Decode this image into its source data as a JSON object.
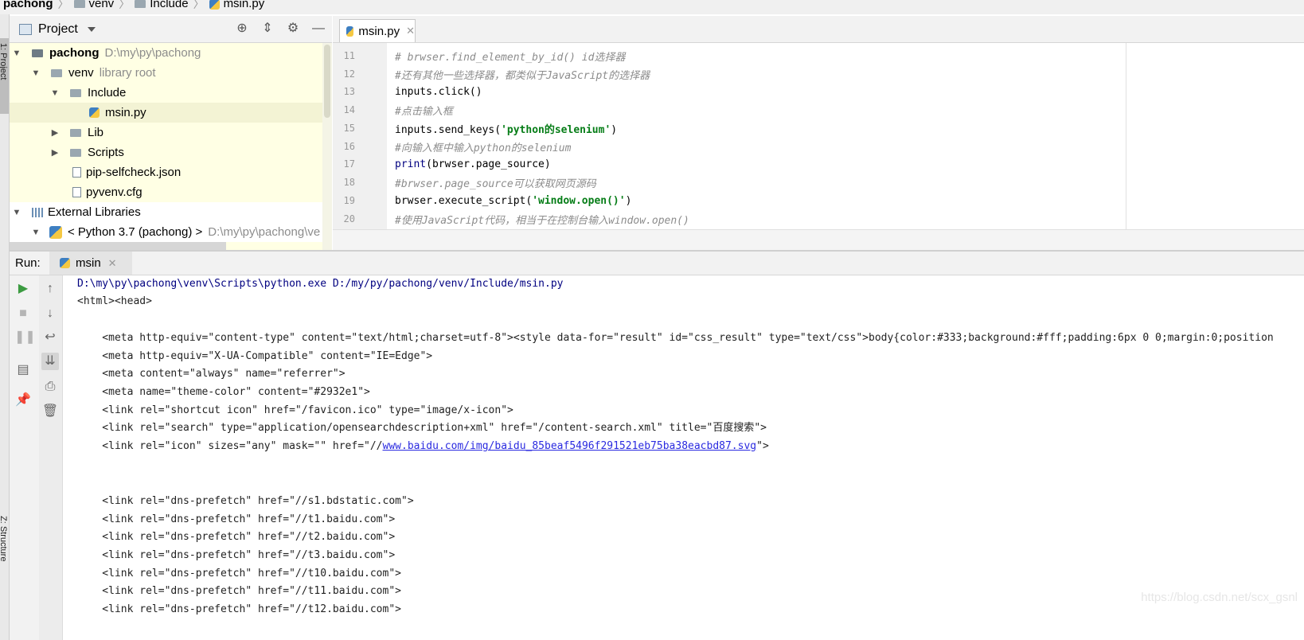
{
  "breadcrumb": [
    "pachong",
    "venv",
    "Include",
    "msin.py"
  ],
  "side_stripe": {
    "project_label": "1: Project",
    "structure_label": "Z: Structure"
  },
  "project_panel": {
    "title": "Project",
    "tree": [
      {
        "label": "pachong",
        "hint": "D:\\my\\py\\pachong",
        "icon": "folder-icon"
      },
      {
        "label": "venv",
        "hint": "library root",
        "icon": "folder-icon"
      },
      {
        "label": "Include",
        "hint": "",
        "icon": "folder-icon"
      },
      {
        "label": "msin.py",
        "hint": "",
        "icon": "python-file-icon"
      },
      {
        "label": "Lib",
        "hint": "",
        "icon": "folder-icon"
      },
      {
        "label": "Scripts",
        "hint": "",
        "icon": "folder-icon"
      },
      {
        "label": "pip-selfcheck.json",
        "hint": "",
        "icon": "json-file-icon"
      },
      {
        "label": "pyvenv.cfg",
        "hint": "",
        "icon": "config-file-icon"
      },
      {
        "label": "External Libraries",
        "hint": "",
        "icon": "library-icon"
      },
      {
        "label": "< Python 3.7 (pachong) >",
        "hint": "D:\\my\\py\\pachong\\ve",
        "icon": "python-icon"
      }
    ]
  },
  "editor": {
    "tab": "msin.py",
    "line_numbers": [
      "11",
      "12",
      "13",
      "14",
      "15",
      "16",
      "17",
      "18",
      "19",
      "20"
    ],
    "lines": [
      {
        "a": "# brwser.find_element_by_id()   id选择器",
        "b": "",
        "c": ""
      },
      {
        "a": "#还有其他一些选择器，都类似于JavaScript的选择器",
        "b": "",
        "c": ""
      },
      {
        "a": "inputs.click()",
        "b": "",
        "c": ""
      },
      {
        "a": "#点击输入框",
        "b": "",
        "c": ""
      },
      {
        "a": "inputs.send_keys(",
        "b": "'python的selenium'",
        "c": ")"
      },
      {
        "a": "#向输入框中输入python的selenium",
        "b": "",
        "c": ""
      },
      {
        "a": "print",
        "b": "(brwser.page_source)",
        "c": ""
      },
      {
        "a": "#brwser.page_source可以获取网页源码",
        "b": "",
        "c": ""
      },
      {
        "a": "brwser.execute_script(",
        "b": "'window.open()'",
        "c": ")"
      },
      {
        "a": "#使用JavaScript代码，相当于在控制台输入window.open()",
        "b": "",
        "c": ""
      }
    ]
  },
  "run_panel": {
    "label": "Run:",
    "tab": "msin",
    "console": [
      "D:\\my\\py\\pachong\\venv\\Scripts\\python.exe D:/my/py/pachong/venv/Include/msin.py",
      "<html><head>",
      "",
      "    <meta http-equiv=\"content-type\" content=\"text/html;charset=utf-8\"><style data-for=\"result\" id=\"css_result\" type=\"text/css\">body{color:#333;background:#fff;padding:6px 0 0;margin:0;position",
      "    <meta http-equiv=\"X-UA-Compatible\" content=\"IE=Edge\">",
      "    <meta content=\"always\" name=\"referrer\">",
      "    <meta name=\"theme-color\" content=\"#2932e1\">",
      "    <link rel=\"shortcut icon\" href=\"/favicon.ico\" type=\"image/x-icon\">",
      "    <link rel=\"search\" type=\"application/opensearchdescription+xml\" href=\"/content-search.xml\" title=\"百度搜索\">",
      "",
      "",
      "",
      "    <link rel=\"dns-prefetch\" href=\"//s1.bdstatic.com\">",
      "    <link rel=\"dns-prefetch\" href=\"//t1.baidu.com\">",
      "    <link rel=\"dns-prefetch\" href=\"//t2.baidu.com\">",
      "    <link rel=\"dns-prefetch\" href=\"//t3.baidu.com\">",
      "    <link rel=\"dns-prefetch\" href=\"//t10.baidu.com\">",
      "    <link rel=\"dns-prefetch\" href=\"//t11.baidu.com\">",
      "    <link rel=\"dns-prefetch\" href=\"//t12.baidu.com\">"
    ],
    "icon_line": {
      "prefix": "    <link rel=\"icon\" sizes=\"any\" mask=\"\" href=\"//",
      "url": "www.baidu.com/img/baidu_85beaf5496f291521eb75ba38eacbd87.svg",
      "suffix": "\">"
    }
  },
  "watermark": "https://blog.csdn.net/scx_gsnl"
}
